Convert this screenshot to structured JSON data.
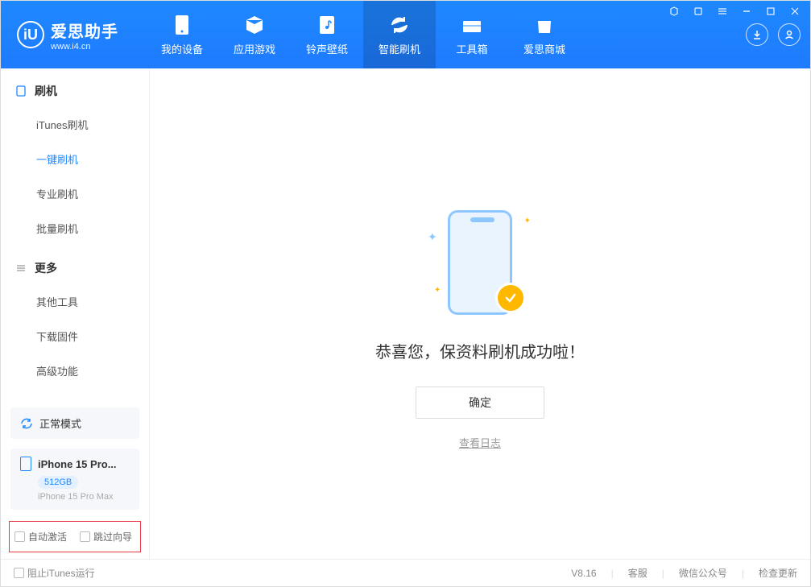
{
  "app": {
    "name": "爱思助手",
    "url": "www.i4.cn",
    "version": "V8.16"
  },
  "nav": [
    {
      "id": "devices",
      "label": "我的设备"
    },
    {
      "id": "apps",
      "label": "应用游戏"
    },
    {
      "id": "ringtones",
      "label": "铃声壁纸"
    },
    {
      "id": "flash",
      "label": "智能刷机",
      "active": true
    },
    {
      "id": "toolbox",
      "label": "工具箱"
    },
    {
      "id": "store",
      "label": "爱思商城"
    }
  ],
  "sidebar": {
    "group1": {
      "title": "刷机",
      "items": [
        {
          "label": "iTunes刷机"
        },
        {
          "label": "一键刷机",
          "active": true
        },
        {
          "label": "专业刷机"
        },
        {
          "label": "批量刷机"
        }
      ]
    },
    "group2": {
      "title": "更多",
      "items": [
        {
          "label": "其他工具"
        },
        {
          "label": "下载固件"
        },
        {
          "label": "高级功能"
        }
      ]
    },
    "mode": "正常模式",
    "device": {
      "name": "iPhone 15 Pro...",
      "storage": "512GB",
      "fullname": "iPhone 15 Pro Max"
    },
    "checks": {
      "auto_activate": "自动激活",
      "skip_wizard": "跳过向导"
    }
  },
  "main": {
    "success_msg": "恭喜您，保资料刷机成功啦！",
    "ok_btn": "确定",
    "view_log": "查看日志"
  },
  "footer": {
    "block_itunes": "阻止iTunes运行",
    "service": "客服",
    "wechat": "微信公众号",
    "check_update": "检查更新"
  }
}
